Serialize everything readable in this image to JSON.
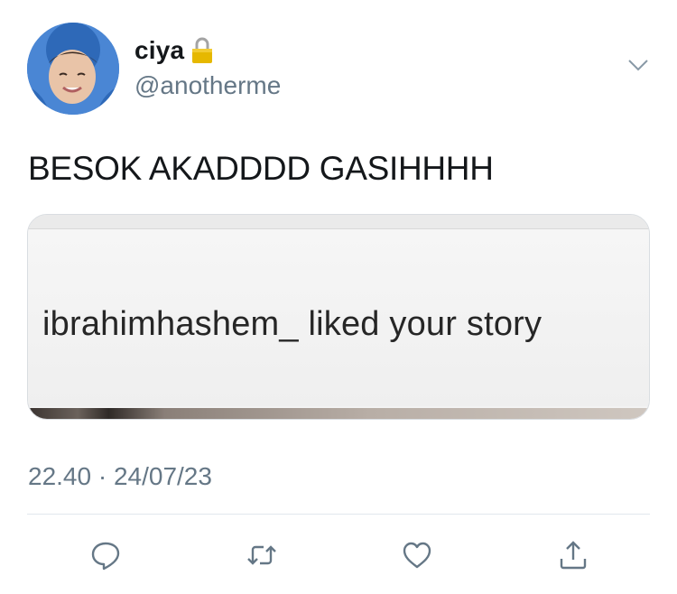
{
  "tweet": {
    "display_name": "ciya",
    "handle": "@anotherme",
    "text": "BESOK AKADDDD GASIHHHH",
    "media_text": "ibrahimhashem_ liked your story",
    "timestamp": "22.40 · 24/07/23"
  },
  "icons": {
    "lock": "lock-icon",
    "chevron": "chevron-down-icon",
    "reply": "reply-icon",
    "retweet": "retweet-icon",
    "like": "heart-icon",
    "share": "share-icon"
  },
  "colors": {
    "text": "#14171a",
    "secondary": "#657786",
    "accent": "#1da1f2",
    "avatar_bg": "#3f7fd0"
  }
}
